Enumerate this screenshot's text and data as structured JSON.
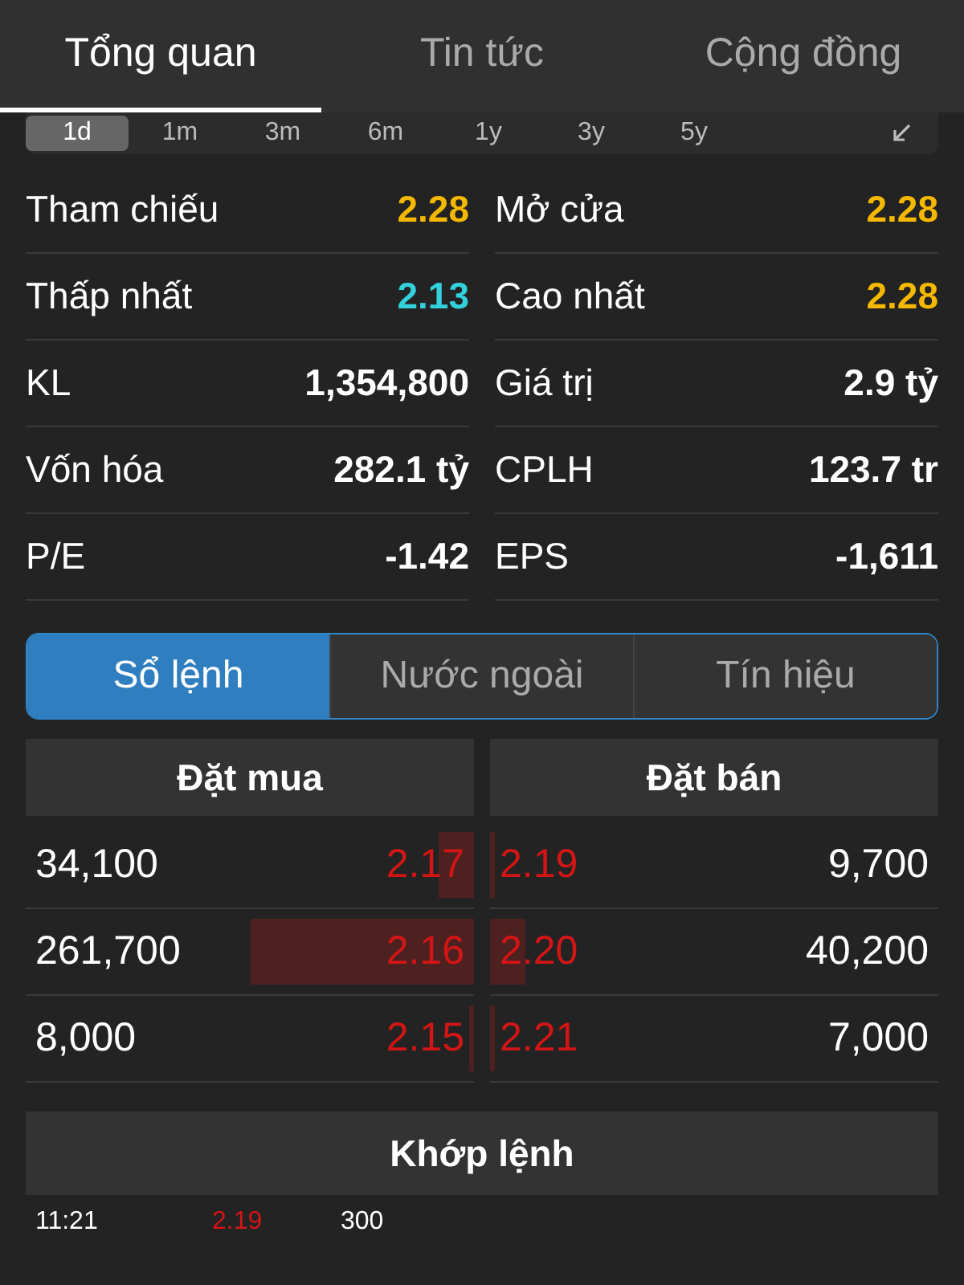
{
  "tabs": [
    {
      "label": "Tổng quan",
      "selected": true
    },
    {
      "label": "Tin tức",
      "selected": false
    },
    {
      "label": "Cộng đồng",
      "selected": false
    }
  ],
  "periods": [
    {
      "label": "1d",
      "selected": true
    },
    {
      "label": "1m",
      "selected": false
    },
    {
      "label": "3m",
      "selected": false
    },
    {
      "label": "6m",
      "selected": false
    },
    {
      "label": "1y",
      "selected": false
    },
    {
      "label": "3y",
      "selected": false
    },
    {
      "label": "5y",
      "selected": false
    }
  ],
  "stats": [
    {
      "label": "Tham chiếu",
      "value": "2.28",
      "color": "#f5b800"
    },
    {
      "label": "Mở cửa",
      "value": "2.28",
      "color": "#f5b800"
    },
    {
      "label": "Thấp nhất",
      "value": "2.13",
      "color": "#33d1dc"
    },
    {
      "label": "Cao nhất",
      "value": "2.28",
      "color": "#f5b800"
    },
    {
      "label": "KL",
      "value": "1,354,800",
      "color": "#ffffff"
    },
    {
      "label": "Giá trị",
      "value": "2.9 tỷ",
      "color": "#ffffff"
    },
    {
      "label": "Vốn hóa",
      "value": "282.1 tỷ",
      "color": "#ffffff"
    },
    {
      "label": "CPLH",
      "value": "123.7 tr",
      "color": "#ffffff"
    },
    {
      "label": "P/E",
      "value": "-1.42",
      "color": "#ffffff"
    },
    {
      "label": "EPS",
      "value": "-1,611",
      "color": "#ffffff"
    }
  ],
  "segments": [
    {
      "label": "Sổ lệnh",
      "selected": true
    },
    {
      "label": "Nước ngoài",
      "selected": false
    },
    {
      "label": "Tín hiệu",
      "selected": false
    }
  ],
  "order_book": {
    "bid_header": "Đặt mua",
    "ask_header": "Đặt bán",
    "rows": [
      {
        "bid": {
          "volume": "34,100",
          "price": "2.17",
          "level": 0.08
        },
        "ask": {
          "price": "2.19",
          "level": 0.01,
          "volume": "9,700"
        }
      },
      {
        "bid": {
          "volume": "261,700",
          "price": "2.16",
          "level": 0.5
        },
        "ask": {
          "price": "2.20",
          "level": 0.08,
          "volume": "40,200"
        }
      },
      {
        "bid": {
          "volume": "8,000",
          "price": "2.15",
          "level": 0.01
        },
        "ask": {
          "price": "2.21",
          "level": 0.01,
          "volume": "7,000"
        }
      }
    ]
  },
  "matched": {
    "title": "Khớp lệnh",
    "rows": [
      {
        "time": "11:21",
        "price": "2.19",
        "volume": "300"
      }
    ]
  }
}
